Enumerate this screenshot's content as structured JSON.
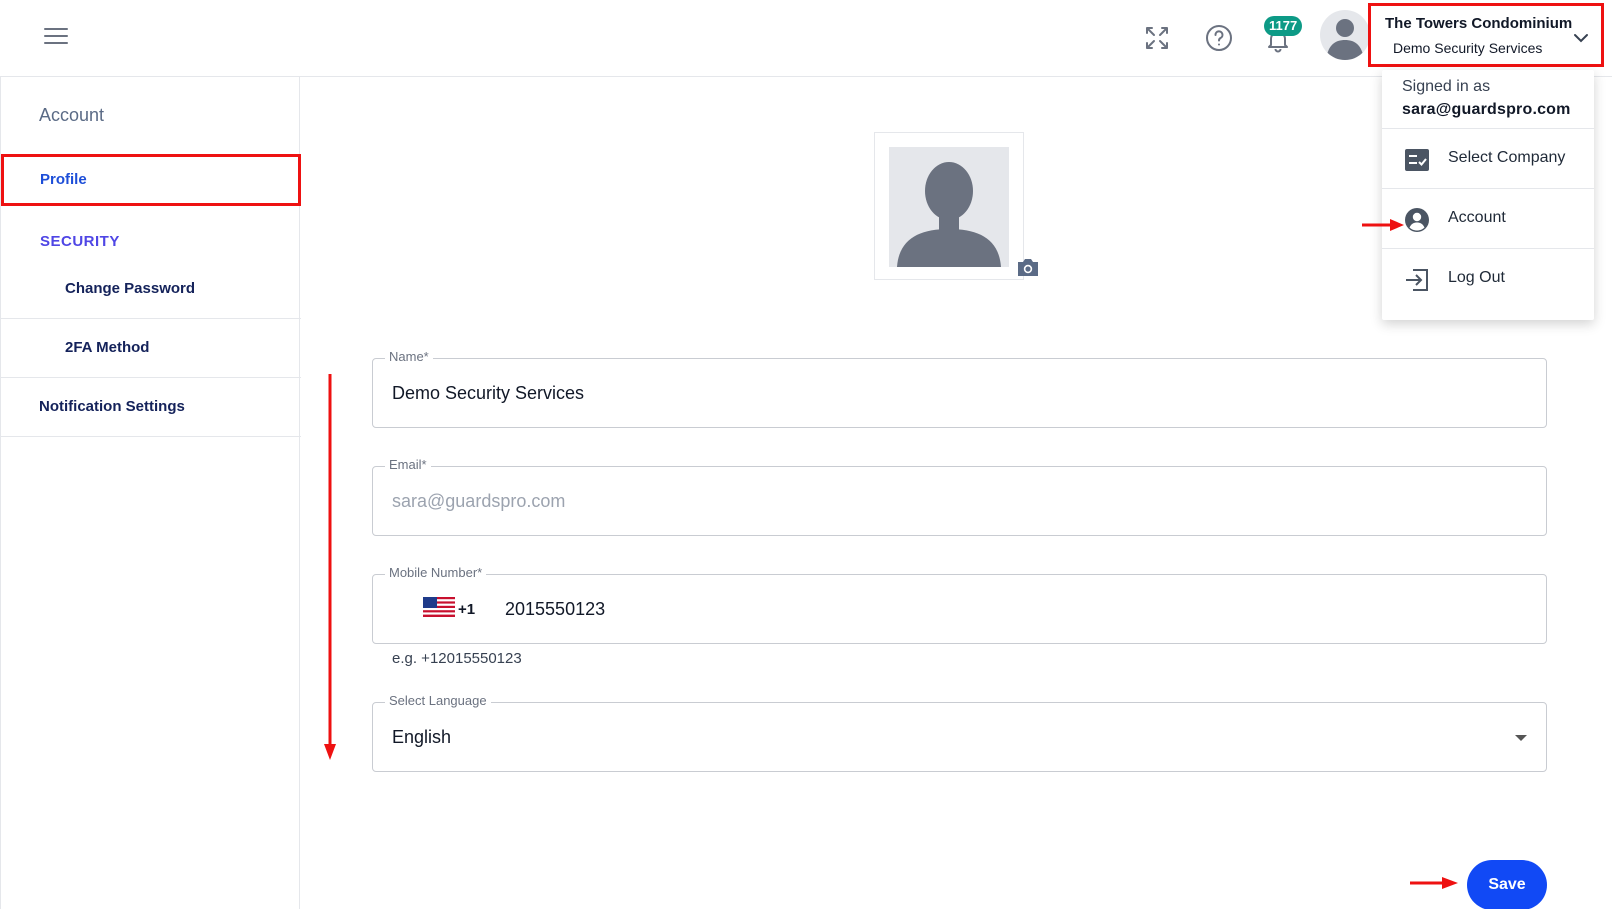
{
  "topbar": {
    "notification_count": "1177",
    "company_name": "The Towers Condominium",
    "company_sub": "Demo Security Services"
  },
  "sidebar": {
    "heading": "Account",
    "profile_label": "Profile",
    "security_heading": "SECURITY",
    "items": [
      {
        "label": "Change Password"
      },
      {
        "label": "2FA Method"
      },
      {
        "label": "Notification Settings"
      }
    ]
  },
  "dropdown": {
    "signed_in_label": "Signed in as",
    "email": "sara@guardspro.com",
    "items": [
      {
        "label": "Select Company",
        "icon": "checklist-icon"
      },
      {
        "label": "Account",
        "icon": "account-circle-icon"
      },
      {
        "label": "Log Out",
        "icon": "logout-icon"
      }
    ]
  },
  "form": {
    "name": {
      "label": "Name*",
      "value": "Demo Security Services"
    },
    "email": {
      "label": "Email*",
      "value": "sara@guardspro.com"
    },
    "mobile": {
      "label": "Mobile Number*",
      "dial_code": "+1",
      "value": "2015550123",
      "hint": "e.g. +12015550123"
    },
    "language": {
      "label": "Select Language",
      "value": "English"
    },
    "save_label": "Save"
  },
  "colors": {
    "accent": "#1149f5",
    "annotation": "#ee1111",
    "badge": "#0d9a86"
  }
}
